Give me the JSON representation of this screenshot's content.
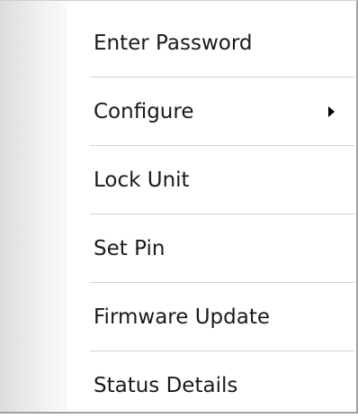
{
  "context_menu": {
    "items": [
      {
        "label": "Enter Password",
        "has_submenu": false
      },
      {
        "label": "Configure",
        "has_submenu": true,
        "submenu_icon": "chevron-right-icon"
      },
      {
        "label": "Lock Unit",
        "has_submenu": false
      },
      {
        "label": "Set Pin",
        "has_submenu": false
      },
      {
        "label": "Firmware Update",
        "has_submenu": false
      },
      {
        "label": "Status Details",
        "has_submenu": false
      }
    ]
  }
}
